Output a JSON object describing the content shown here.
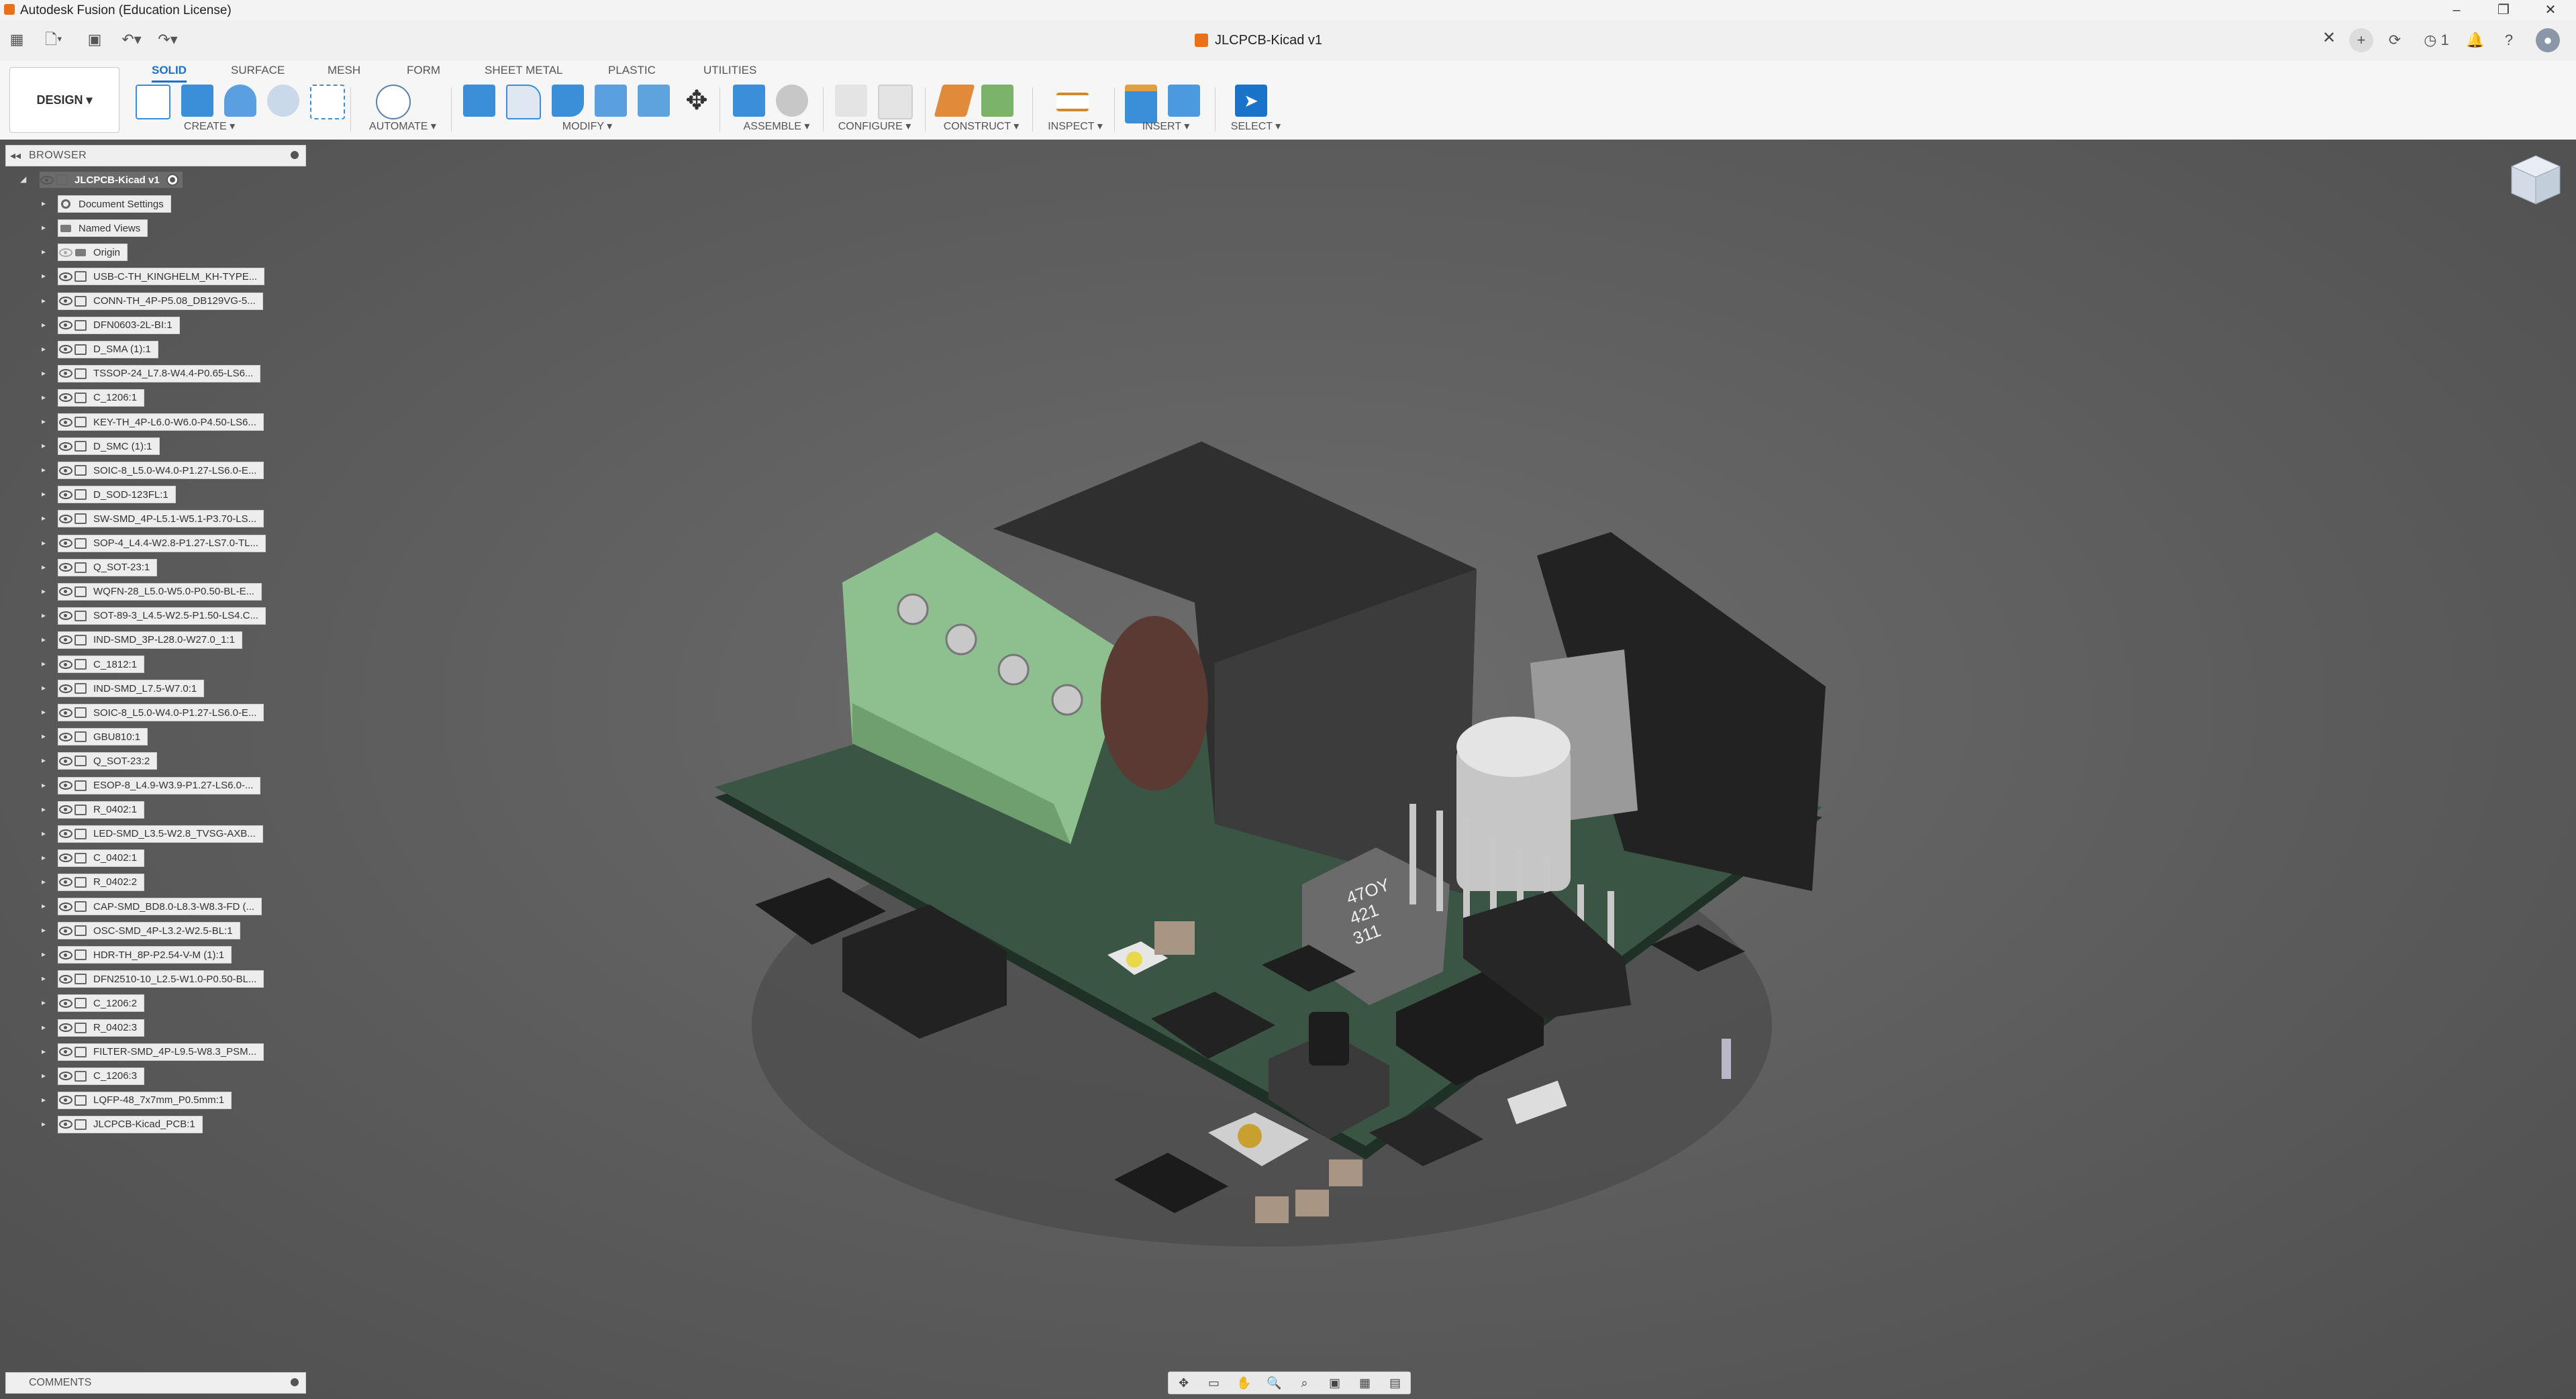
{
  "app": {
    "window_title": "Autodesk Fusion (Education License)"
  },
  "document": {
    "title": "JLCPCB-Kicad v1"
  },
  "toolbar_right": {
    "notifications": "1"
  },
  "workspace": {
    "label": "DESIGN ▾"
  },
  "ribbon": {
    "tabs": [
      "SOLID",
      "SURFACE",
      "MESH",
      "FORM",
      "SHEET METAL",
      "PLASTIC",
      "UTILITIES"
    ],
    "active_tab": "SOLID",
    "groups": {
      "create": "CREATE ▾",
      "automate": "AUTOMATE ▾",
      "modify": "MODIFY ▾",
      "assemble": "ASSEMBLE ▾",
      "configure": "CONFIGURE ▾",
      "construct": "CONSTRUCT ▾",
      "inspect": "INSPECT ▾",
      "insert": "INSERT ▾",
      "select": "SELECT ▾"
    }
  },
  "browser": {
    "title": "BROWSER",
    "root": "JLCPCB-Kicad v1",
    "items": [
      "Document Settings",
      "Named Views",
      "Origin",
      "USB-C-TH_KINGHELM_KH-TYPE...",
      "CONN-TH_4P-P5.08_DB129VG-5...",
      "DFN0603-2L-BI:1",
      "D_SMA (1):1",
      "TSSOP-24_L7.8-W4.4-P0.65-LS6...",
      "C_1206:1",
      "KEY-TH_4P-L6.0-W6.0-P4.50-LS6...",
      "D_SMC (1):1",
      "SOIC-8_L5.0-W4.0-P1.27-LS6.0-E...",
      "D_SOD-123FL:1",
      "SW-SMD_4P-L5.1-W5.1-P3.70-LS...",
      "SOP-4_L4.4-W2.8-P1.27-LS7.0-TL...",
      "Q_SOT-23:1",
      "WQFN-28_L5.0-W5.0-P0.50-BL-E...",
      "SOT-89-3_L4.5-W2.5-P1.50-LS4.C...",
      "IND-SMD_3P-L28.0-W27.0_1:1",
      "C_1812:1",
      "IND-SMD_L7.5-W7.0:1",
      "SOIC-8_L5.0-W4.0-P1.27-LS6.0-E...",
      "GBU810:1",
      "Q_SOT-23:2",
      "ESOP-8_L4.9-W3.9-P1.27-LS6.0-...",
      "R_0402:1",
      "LED-SMD_L3.5-W2.8_TVSG-AXB...",
      "C_0402:1",
      "R_0402:2",
      "CAP-SMD_BD8.0-L8.3-W8.3-FD (...",
      "OSC-SMD_4P-L3.2-W2.5-BL:1",
      "HDR-TH_8P-P2.54-V-M (1):1",
      "DFN2510-10_L2.5-W1.0-P0.50-BL...",
      "C_1206:2",
      "R_0402:3",
      "FILTER-SMD_4P-L9.5-W8.3_PSM...",
      "C_1206:3",
      "LQFP-48_7x7mm_P0.5mm:1",
      "JLCPCB-Kicad_PCB:1"
    ]
  },
  "comments": {
    "title": "COMMENTS"
  },
  "component_markings": {
    "inductor": "47OY\n421\n311"
  },
  "colors": {
    "accent": "#1a73c9",
    "pcb": "#3b5545",
    "terminal_block": "#8ebf8e",
    "brand_orange": "#e8711a"
  }
}
